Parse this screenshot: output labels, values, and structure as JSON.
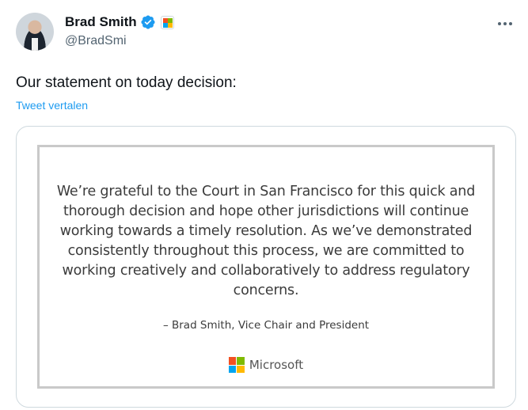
{
  "author": {
    "display_name": "Brad Smith",
    "handle": "@BradSmi",
    "verified_color": "#1d9bf0"
  },
  "tweet": {
    "text": "Our statement on today decision:",
    "translate_label": "Tweet vertalen"
  },
  "statement": {
    "quote_lines": [
      "We’re grateful to the Court in San Francisco for this quick and",
      "thorough decision and hope other jurisdictions will continue",
      "working towards a timely resolution. As we’ve demonstrated",
      "consistently throughout this process, we are committed to",
      "working creatively and collaboratively to address regulatory",
      "concerns."
    ],
    "attribution": "– Brad Smith, Vice Chair and President",
    "brand": "Microsoft"
  },
  "colors": {
    "link": "#1d9bf0",
    "secondary_text": "#536471"
  }
}
